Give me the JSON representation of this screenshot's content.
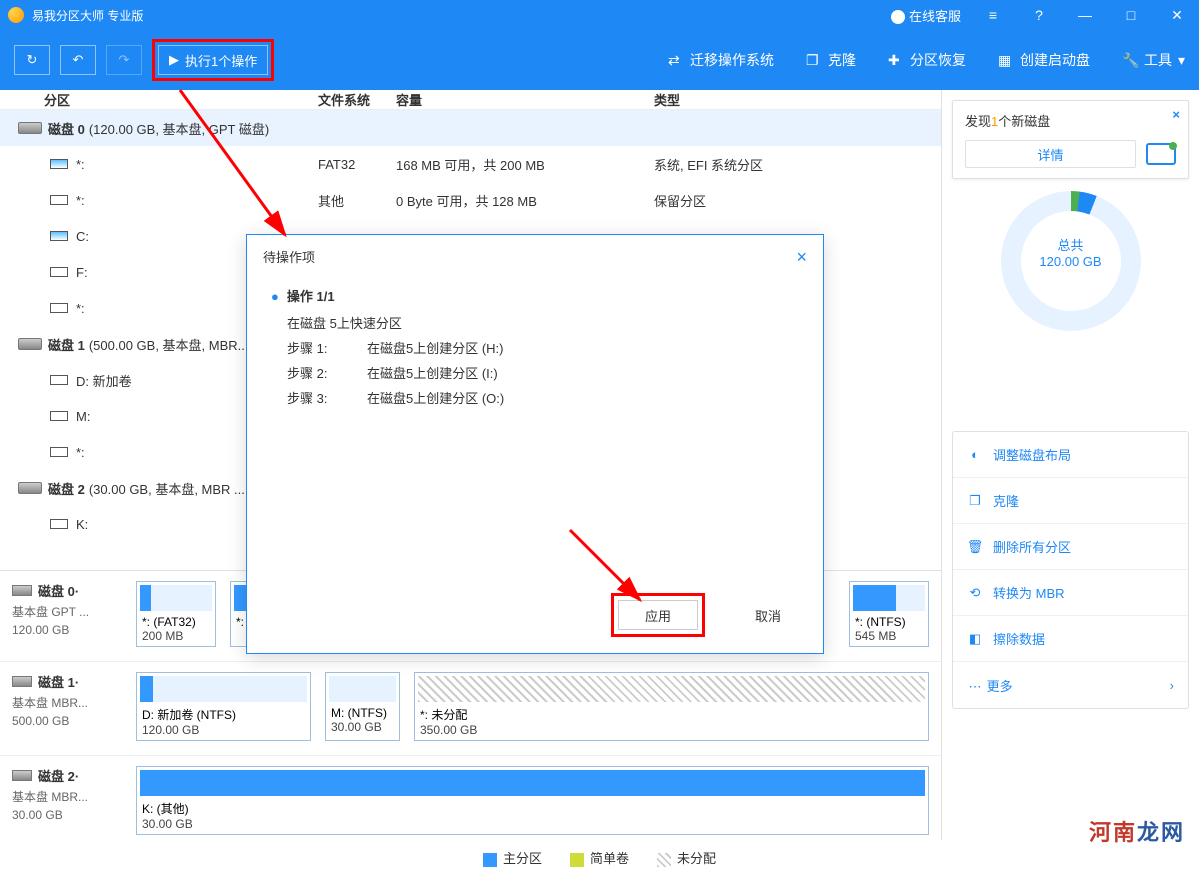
{
  "titlebar": {
    "app_title": "易我分区大师 专业版",
    "support": "在线客服"
  },
  "toolbar": {
    "execute_label": "执行1个操作",
    "migrate": "迁移操作系统",
    "clone": "克隆",
    "recover": "分区恢复",
    "bootdisk": "创建启动盘",
    "tools": "工具",
    "tools_arrow": "▾"
  },
  "table": {
    "headers": {
      "partition": "分区",
      "fs": "文件系统",
      "capacity": "容量",
      "type": "类型"
    },
    "disk0": {
      "label": "磁盘 0",
      "info": "(120.00 GB, 基本盘, GPT 磁盘)"
    },
    "rows": {
      "efi": {
        "drive": "*:",
        "fs": "FAT32",
        "cap": "168 MB   可用，共   200 MB",
        "type": "系统, EFI 系统分区"
      },
      "rsv": {
        "drive": "*:",
        "fs": "其他",
        "cap": "0 Byte   可用，共   128 MB",
        "type": "保留分区"
      },
      "c": {
        "drive": "C:"
      },
      "f": {
        "drive": "F:"
      },
      "star": {
        "drive": "*:"
      }
    },
    "disk1": {
      "label": "磁盘 1",
      "info": "(500.00 GB, 基本盘, MBR..."
    },
    "rows1": {
      "d": {
        "drive": "D: 新加卷"
      },
      "m": {
        "drive": "M:"
      },
      "s": {
        "drive": "*:"
      }
    },
    "disk2": {
      "label": "磁盘 2",
      "info": "(30.00 GB, 基本盘, MBR ..."
    },
    "rows2": {
      "k": {
        "drive": "K:"
      }
    }
  },
  "disk_visual": {
    "d0": {
      "name": "磁盘 0·",
      "type": "基本盘 GPT ...",
      "size": "120.00 GB",
      "p1": {
        "name": "*: (FAT32)",
        "size": "200 MB"
      },
      "p2": {
        "name": "*:",
        "size": ""
      },
      "p3": {
        "name": "",
        "size": ""
      },
      "p4": {
        "name": "*: (NTFS)",
        "size": "545 MB"
      }
    },
    "d1": {
      "name": "磁盘 1·",
      "type": "基本盘 MBR...",
      "size": "500.00 GB",
      "p1": {
        "name": "D: 新加卷 (NTFS)",
        "size": "120.00 GB"
      },
      "p2": {
        "name": "M:  (NTFS)",
        "size": "30.00 GB"
      },
      "p3": {
        "name": "*: 未分配",
        "size": "350.00 GB"
      }
    },
    "d2": {
      "name": "磁盘 2·",
      "type": "基本盘 MBR...",
      "size": "30.00 GB",
      "p1": {
        "name": "K: (其他)",
        "size": "30.00 GB"
      }
    }
  },
  "right": {
    "notify_title": "发现1个新磁盘",
    "detail": "详情",
    "total_label": "总共",
    "total_size": "120.00 GB",
    "actions": {
      "adjust": "调整磁盘布局",
      "clone": "克隆",
      "delall": "删除所有分区",
      "convert": "转换为 MBR",
      "wipe": "擦除数据",
      "more": "更多"
    },
    "more_arrow": "›"
  },
  "modal": {
    "title": "待操作项",
    "op_header": "操作 1/1",
    "op_desc": "在磁盘 5上快速分区",
    "step1_label": "步骤 1:",
    "step1_text": "在磁盘5上创建分区 (H:)",
    "step2_label": "步骤 2:",
    "step2_text": "在磁盘5上创建分区 (I:)",
    "step3_label": "步骤 3:",
    "step3_text": "在磁盘5上创建分区 (O:)",
    "apply": "应用",
    "cancel": "取消"
  },
  "legend": {
    "primary": "主分区",
    "simple": "简单卷",
    "unalloc": "未分配"
  },
  "watermark": {
    "a": "河南",
    "b": "龙网"
  }
}
